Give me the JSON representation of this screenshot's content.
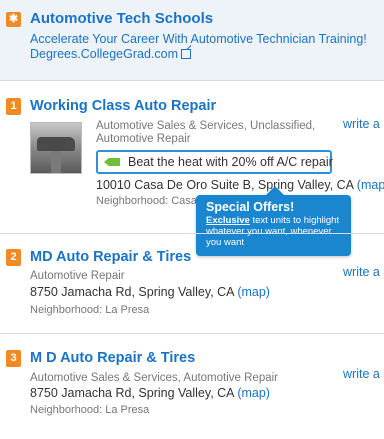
{
  "sponsored": {
    "title": "Automotive Tech Schools",
    "text": "Accelerate Your Career With Automotive Technician Training!",
    "url": "Degrees.CollegeGrad.com"
  },
  "listings": [
    {
      "rank": "1",
      "name": "Working Class Auto Repair",
      "categories_line1": "Automotive Sales & Services, Unclassified,",
      "categories_line2": "Automotive Repair",
      "offer": "Beat the heat with 20% off A/C repair",
      "address": "10010 Casa De Oro Suite B, Spring Valley, CA",
      "map": "(map)",
      "neighborhood": "Neighborhood: Casa",
      "review": "write a r"
    },
    {
      "rank": "2",
      "name": "MD Auto Repair & Tires",
      "categories": "Automotive Repair",
      "address": "8750 Jamacha Rd, Spring Valley, CA",
      "map": "(map)",
      "neighborhood": "Neighborhood: La Presa",
      "review": "write a r"
    },
    {
      "rank": "3",
      "name": "M D Auto Repair & Tires",
      "categories": "Automotive Sales & Services, Automotive Repair",
      "address": "8750 Jamacha Rd, Spring Valley, CA",
      "map": "(map)",
      "neighborhood": "Neighborhood: La Presa",
      "review": "write a r"
    }
  ],
  "tooltip": {
    "title": "Special Offers!",
    "emph": "Exclusive",
    "body": " text units to highlight whatever you want, whenever you want"
  },
  "colors": {
    "link": "#1a73c4",
    "badge": "#f08a24",
    "tooltip_bg": "#1a86d0",
    "offer_tag": "#6bbf3a"
  }
}
